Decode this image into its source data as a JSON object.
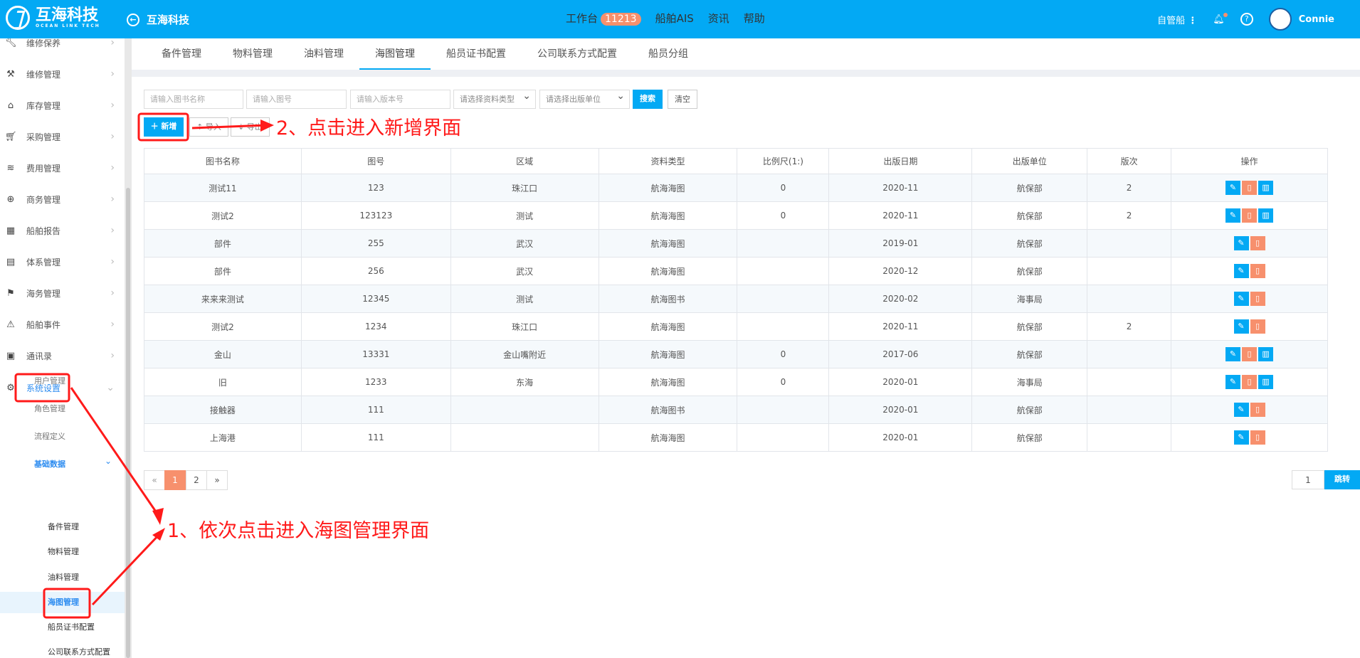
{
  "header": {
    "logo_title": "互海科技",
    "logo_sub": "OCEAN LINK TECH",
    "back_title": "互海科技",
    "nav": [
      {
        "label": "工作台",
        "badge": "11213"
      },
      {
        "label": "船舶AIS"
      },
      {
        "label": "资讯"
      },
      {
        "label": "帮助"
      }
    ],
    "ship_label": "自管船",
    "user": "Connie"
  },
  "sidebar": {
    "items": [
      {
        "label": "维修保养",
        "icon": "wrench-tool-icon"
      },
      {
        "label": "维修管理",
        "icon": "wrench-icon"
      },
      {
        "label": "库存管理",
        "icon": "home-icon"
      },
      {
        "label": "采购管理",
        "icon": "cart-icon"
      },
      {
        "label": "费用管理",
        "icon": "database-icon"
      },
      {
        "label": "商务管理",
        "icon": "globe-icon"
      },
      {
        "label": "船舶报告",
        "icon": "calendar-icon"
      },
      {
        "label": "体系管理",
        "icon": "document-icon"
      },
      {
        "label": "海务管理",
        "icon": "signpost-icon"
      },
      {
        "label": "船舶事件",
        "icon": "warning-icon"
      },
      {
        "label": "通讯录",
        "icon": "contacts-icon"
      },
      {
        "label": "系统设置",
        "icon": "gear-icon"
      }
    ],
    "sub": [
      "用户管理",
      "角色管理",
      "流程定义",
      "基础数据"
    ],
    "sub2": [
      "备件管理",
      "物料管理",
      "油料管理",
      "海图管理",
      "船员证书配置",
      "公司联系方式配置"
    ]
  },
  "tabs": [
    "备件管理",
    "物料管理",
    "油料管理",
    "海图管理",
    "船员证书配置",
    "公司联系方式配置",
    "船员分组"
  ],
  "filters": {
    "name_ph": "请输入图书名称",
    "no_ph": "请输入图号",
    "ver_ph": "请输入版本号",
    "type_ph": "请选择资料类型",
    "unit_ph": "请选择出版单位",
    "search": "搜索",
    "clear": "清空"
  },
  "toolbar": {
    "add": "新增",
    "import": "导入",
    "export": "导出"
  },
  "table": {
    "headers": [
      "图书名称",
      "图号",
      "区域",
      "资料类型",
      "比例尺(1:)",
      "出版日期",
      "出版单位",
      "版次",
      "操作"
    ],
    "rows": [
      [
        "测试11",
        "123",
        "珠江口",
        "航海海图",
        "0",
        "2020-11",
        "航保部",
        "2",
        3
      ],
      [
        "测试2",
        "123123",
        "测试",
        "航海海图",
        "0",
        "2020-11",
        "航保部",
        "2",
        3
      ],
      [
        "部件",
        "255",
        "武汉",
        "航海海图",
        "",
        "2019-01",
        "航保部",
        "",
        2
      ],
      [
        "部件",
        "256",
        "武汉",
        "航海海图",
        "",
        "2020-12",
        "航保部",
        "",
        2
      ],
      [
        "来来来测试",
        "12345",
        "测试",
        "航海图书",
        "",
        "2020-02",
        "海事局",
        "",
        2
      ],
      [
        "测试2",
        "1234",
        "珠江口",
        "航海海图",
        "",
        "2020-11",
        "航保部",
        "2",
        2
      ],
      [
        "金山",
        "13331",
        "金山嘴附近",
        "航海海图",
        "0",
        "2017-06",
        "航保部",
        "",
        3
      ],
      [
        "旧",
        "1233",
        "东海",
        "航海海图",
        "0",
        "2020-01",
        "海事局",
        "",
        3
      ],
      [
        "接触器",
        "111",
        "",
        "航海图书",
        "",
        "2020-01",
        "航保部",
        "",
        2
      ],
      [
        "上海港",
        "111",
        "",
        "航海海图",
        "",
        "2020-01",
        "航保部",
        "",
        2
      ]
    ]
  },
  "pagination": {
    "prev": "«",
    "pages": [
      "1",
      "2"
    ],
    "next": "»",
    "current": "1",
    "jump_value": "1",
    "jump": "跳转"
  },
  "annotations": {
    "step1": "1、依次点击进入海图管理界面",
    "step2": "2、点击进入新增界面"
  },
  "colors": {
    "primary": "#03a9f4",
    "danger": "#f7906d",
    "annotation": "#ff1a1a"
  }
}
